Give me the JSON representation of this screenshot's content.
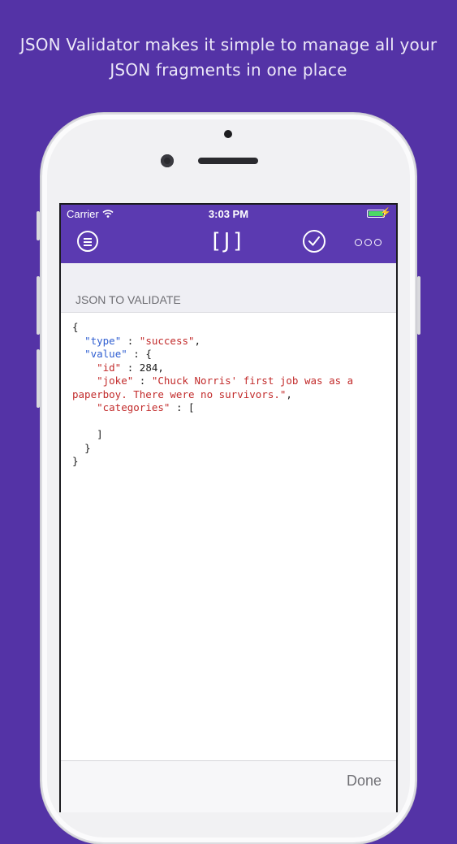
{
  "headline": {
    "line1": "JSON Validator makes it simple to manage all your",
    "line2": "JSON fragments in one place"
  },
  "status_bar": {
    "carrier": "Carrier",
    "time": "3:03 PM",
    "battery_level": 1.0
  },
  "nav": {
    "logo": "[J]",
    "menu_icon": "menu-icon",
    "validate_icon": "checkmark-circle-icon",
    "more_icon": "more-icon"
  },
  "section": {
    "title": "JSON TO VALIDATE"
  },
  "json_text": {
    "open_brace": "{",
    "type_key": "\"type\"",
    "type_val": "\"success\"",
    "value_key": "\"value\"",
    "id_key": "\"id\"",
    "id_val": "284",
    "joke_key": "\"joke\"",
    "joke_val_part1": "\"Chuck Norris' first job was as a",
    "joke_val_part2": "paperboy. There were no survivors.\"",
    "categories_key": "\"categories\"",
    "open_bracket": "[",
    "close_bracket": "]",
    "close_brace_inner": "}",
    "close_brace_outer": "}"
  },
  "toolbar": {
    "done_label": "Done"
  },
  "colors": {
    "background": "#5433a6",
    "nav_bar": "#5b3ab1",
    "json_key": "#2f5ed1",
    "json_string": "#c22b2b",
    "battery": "#4cd964"
  }
}
